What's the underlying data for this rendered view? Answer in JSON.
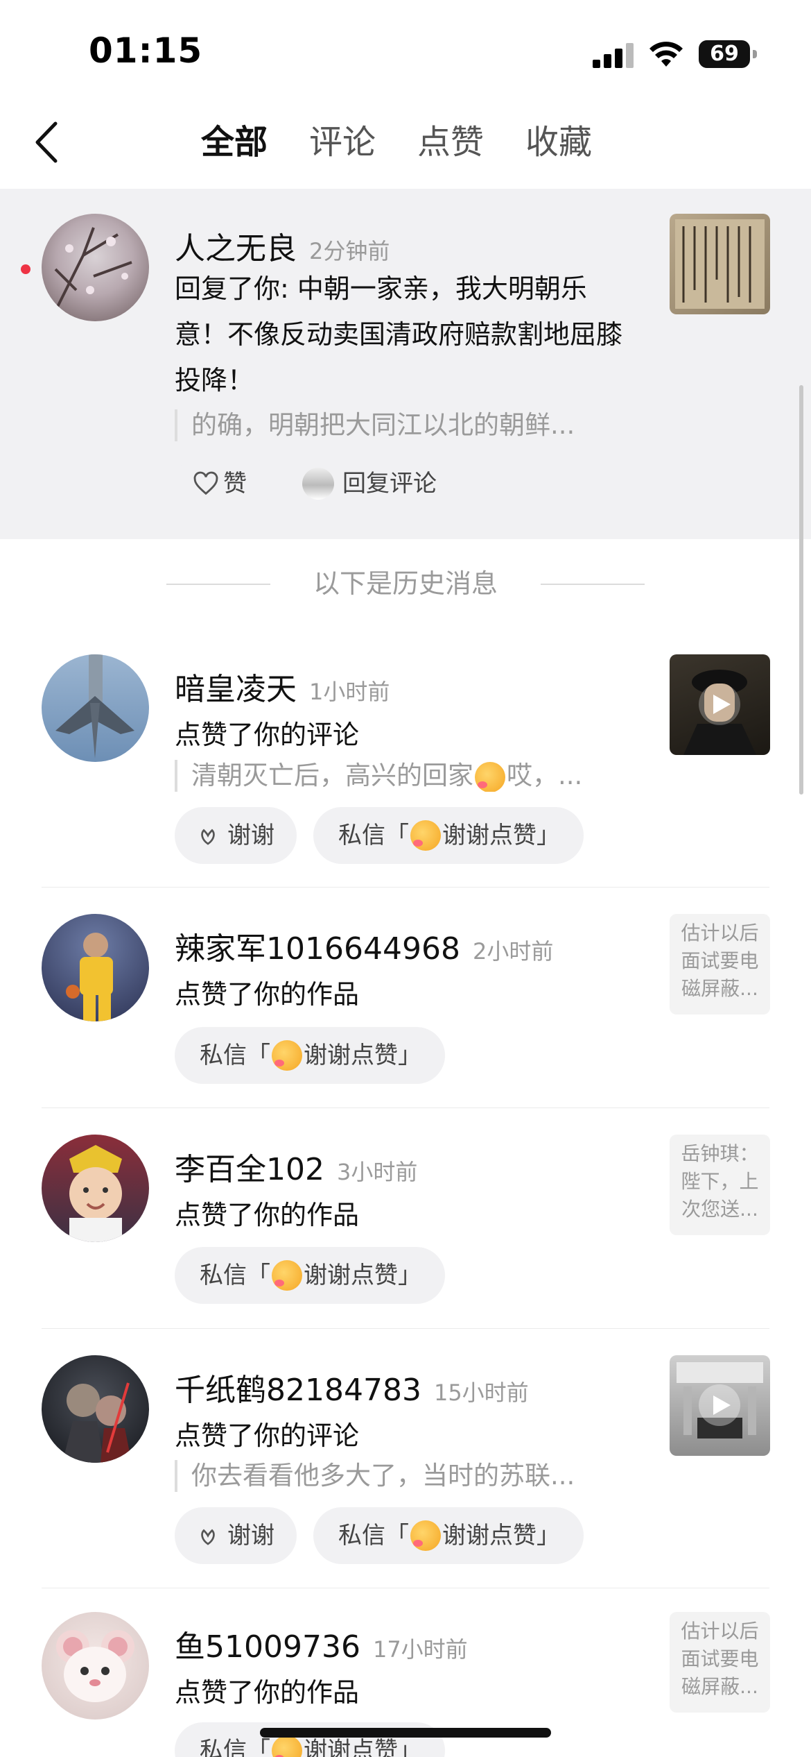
{
  "status_bar": {
    "time": "01:15",
    "battery": "69"
  },
  "header": {
    "tabs": [
      {
        "label": "全部"
      },
      {
        "label": "评论"
      },
      {
        "label": "点赞"
      },
      {
        "label": "收藏"
      }
    ]
  },
  "highlight": {
    "name": "人之无良",
    "time": "2分钟前",
    "reply_text": "回复了你: 中朝一家亲，我大明朝乐意！不像反动卖国清政府赔款割地屈膝投降！",
    "quote": "的确，明朝把大同江以北的朝鲜...",
    "like_label": "赞",
    "reply_label": "回复评论"
  },
  "history_label": "以下是历史消息",
  "items": [
    {
      "name": "暗皇凌天",
      "time": "1小时前",
      "action": "点赞了你的评论",
      "quote": "清朝灭亡后，高兴的回家",
      "quote_tail": "哎，...",
      "thanks_label": "谢谢",
      "dm_prefix": "私信「",
      "dm_suffix": "谢谢点赞」"
    },
    {
      "name": "辣家军1016644968",
      "time": "2小时前",
      "action": "点赞了你的作品",
      "thumb_text": "估计以后面试要电磁屏蔽...",
      "dm_prefix": "私信「",
      "dm_suffix": "谢谢点赞」"
    },
    {
      "name": "李百全102",
      "time": "3小时前",
      "action": "点赞了你的作品",
      "thumb_text": "岳钟琪：陛下，上次您送...",
      "dm_prefix": "私信「",
      "dm_suffix": "谢谢点赞」"
    },
    {
      "name": "千纸鹤82184783",
      "time": "15小时前",
      "action": "点赞了你的评论",
      "quote": "你去看看他多大了，当时的苏联...",
      "thanks_label": "谢谢",
      "dm_prefix": "私信「",
      "dm_suffix": "谢谢点赞」"
    },
    {
      "name": "鱼51009736",
      "time": "17小时前",
      "action": "点赞了你的作品",
      "thumb_text": "估计以后面试要电磁屏蔽...",
      "dm_prefix": "私信「",
      "dm_suffix": "谢谢点赞」"
    }
  ],
  "colors": {
    "unread_dot": "#ee3344",
    "highlight_bg": "#f1f1f3",
    "muted_text": "#9a9a9a"
  }
}
